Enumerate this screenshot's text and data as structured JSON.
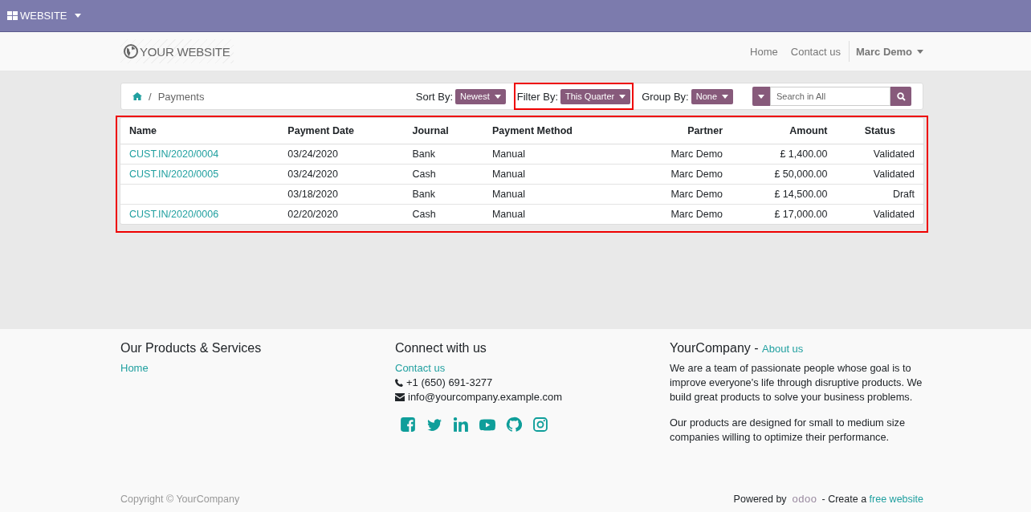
{
  "top_bar": {
    "app_menu": "WEBSITE"
  },
  "header": {
    "logo": "YOUR WEBSITE",
    "nav": [
      {
        "label": "Home"
      },
      {
        "label": "Contact us"
      }
    ],
    "user": "Marc Demo"
  },
  "toolbar": {
    "breadcrumb_separator": "/",
    "breadcrumb": "Payments",
    "controls": [
      {
        "label": "Sort By:",
        "value": "Newest",
        "highlighted": false
      },
      {
        "label": "Filter By:",
        "value": "This Quarter",
        "highlighted": true
      },
      {
        "label": "Group By:",
        "value": "None",
        "highlighted": false
      }
    ],
    "search": {
      "placeholder": "Search in All"
    }
  },
  "table": {
    "highlighted": true,
    "columns": [
      "Name",
      "Payment Date",
      "Journal",
      "Payment Method",
      "Partner",
      "Amount",
      "Status"
    ],
    "rows": [
      {
        "name": "CUST.IN/2020/0004",
        "date": "03/24/2020",
        "journal": "Bank",
        "method": "Manual",
        "partner": "Marc Demo",
        "amount": "£ 1,400.00",
        "status": "Validated"
      },
      {
        "name": "CUST.IN/2020/0005",
        "date": "03/24/2020",
        "journal": "Cash",
        "method": "Manual",
        "partner": "Marc Demo",
        "amount": "£ 50,000.00",
        "status": "Validated"
      },
      {
        "date": "03/18/2020",
        "journal": "Bank",
        "method": "Manual",
        "partner": "Marc Demo",
        "amount": "£ 14,500.00",
        "status": "Draft"
      },
      {
        "name": "CUST.IN/2020/0006",
        "date": "02/20/2020",
        "journal": "Cash",
        "method": "Manual",
        "partner": "Marc Demo",
        "amount": "£ 17,000.00",
        "status": "Validated"
      }
    ]
  },
  "footer": {
    "products": {
      "title": "Our Products & Services",
      "links": [
        "Home"
      ]
    },
    "connect": {
      "title": "Connect with us",
      "link": "Contact us",
      "phone": "+1 (650) 691-3277",
      "email": "info@yourcompany.example.com"
    },
    "about": {
      "title": "YourCompany",
      "separator": "-",
      "link": "About us",
      "paragraphs": [
        "We are a team of passionate people whose goal is to improve everyone's life through disruptive products. We build great products to solve your business problems.",
        "Our products are designed for small to medium size companies willing to optimize their performance."
      ]
    },
    "copyright": "Copyright © YourCompany",
    "powered": {
      "prefix": "Powered by",
      "brand": "odoo",
      "middle": "- Create a",
      "link": "free website"
    }
  }
}
